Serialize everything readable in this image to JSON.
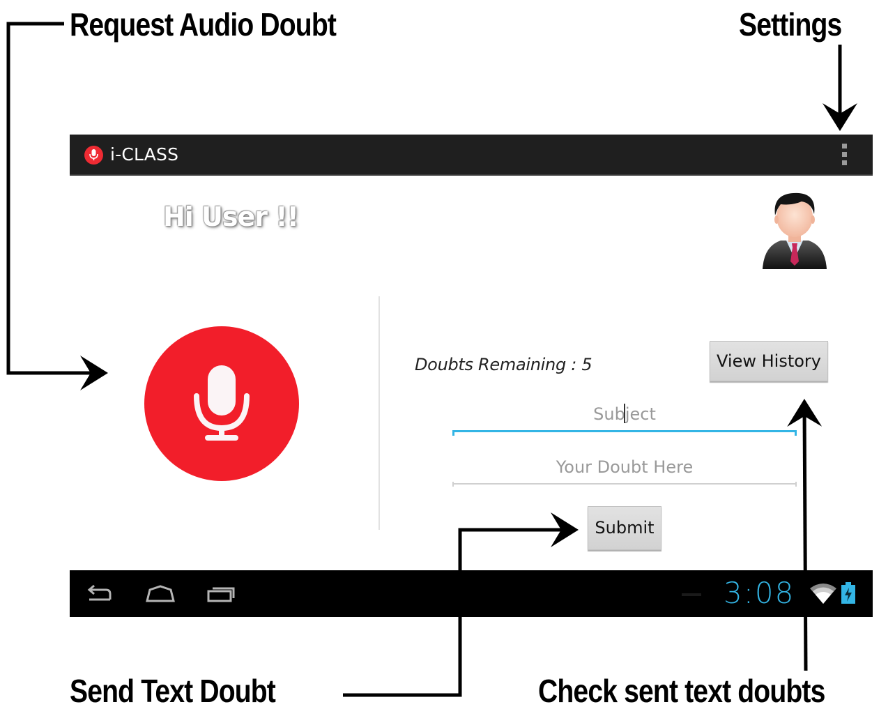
{
  "annotations": {
    "request_audio": "Request Audio Doubt",
    "settings": "Settings",
    "send_text": "Send Text Doubt",
    "check_sent": "Check sent text doubts"
  },
  "action_bar": {
    "app_icon": "mic-icon",
    "title": "i-CLASS",
    "menu_icon": "overflow-menu-icon"
  },
  "main": {
    "greeting": "Hi User !!",
    "avatar_icon": "user-avatar-icon",
    "mic_button_icon": "microphone-icon",
    "doubts_remaining": "Doubts Remaining : 5",
    "view_history_label": "View History",
    "subject_placeholder": "Subject",
    "doubt_placeholder": "Your Doubt Here",
    "submit_label": "Submit"
  },
  "system_bar": {
    "back_icon": "back-icon",
    "home_icon": "home-icon",
    "recents_icon": "recent-apps-icon",
    "time": "3:08",
    "wifi_icon": "wifi-icon",
    "battery_icon": "battery-charging-icon"
  },
  "colors": {
    "accent_red": "#f21e2a",
    "holo_blue": "#33b5e5",
    "action_bar": "#1f1f1f"
  }
}
